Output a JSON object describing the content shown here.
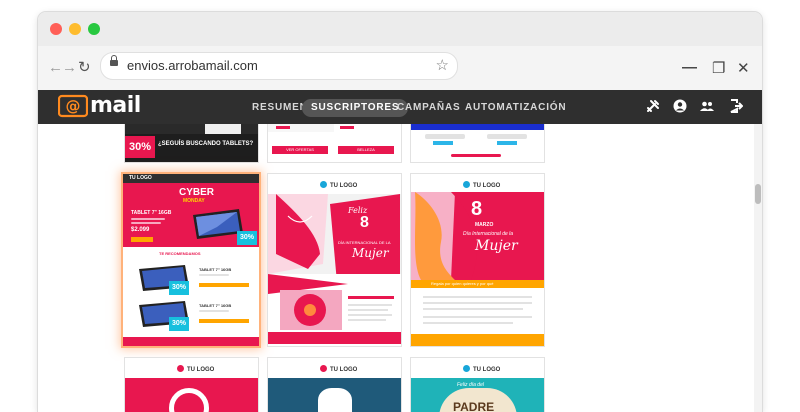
{
  "browser": {
    "url": "envios.arrobamail.com",
    "back_glyph": "←",
    "forward_glyph": "→",
    "reload_glyph": "↻",
    "star_glyph": "☆",
    "minimize_glyph": "—",
    "restore_glyph": "❐",
    "close_glyph": "✕"
  },
  "app": {
    "logo_text": "mail",
    "logo_at": "@",
    "menu": [
      {
        "label": "RESUMEN"
      },
      {
        "label": "SUSCRIPTORES"
      },
      {
        "label": "CAMPAÑAS"
      },
      {
        "label": "AUTOMATIZACIÓN"
      }
    ],
    "active_menu": "SUSCRIPTORES"
  },
  "templates": {
    "top_row": {
      "banner_text": "¿SEGUÍS BUSCANDO TABLETS?",
      "banner_percent": "30%",
      "button_1": "VER OFERTAS",
      "button_2": "BELLEZA"
    },
    "cyber": {
      "header_logo": "TU LOGO",
      "title_1": "CYBER",
      "title_2": "MONDAY",
      "product": "TABLET 7\" 16GB",
      "price": "$2.099",
      "badge": "30%",
      "section": "TE RECOMENDAMOS",
      "item_1": "TABLET 7\" 16GB",
      "item_2": "TABLET 7\" 16GB",
      "item_badge": "30%"
    },
    "mujer_1": {
      "logo": "TU LOGO",
      "script_1": "Feliz",
      "day": "8",
      "caption": "DÍA INTERNACIONAL DE LA",
      "script_2": "Mujer"
    },
    "mujer_2": {
      "logo": "TU LOGO",
      "day": "8",
      "month": "MARZO",
      "caption": "Día Internacional de la",
      "script": "Mujer",
      "banner": "Regala por quien quieres y por qué"
    },
    "bottom": {
      "logo_1": "TU LOGO",
      "logo_2": "TU LOGO",
      "logo_3": "TU LOGO",
      "padre": "PADRE",
      "feliz": "Feliz día del"
    }
  }
}
